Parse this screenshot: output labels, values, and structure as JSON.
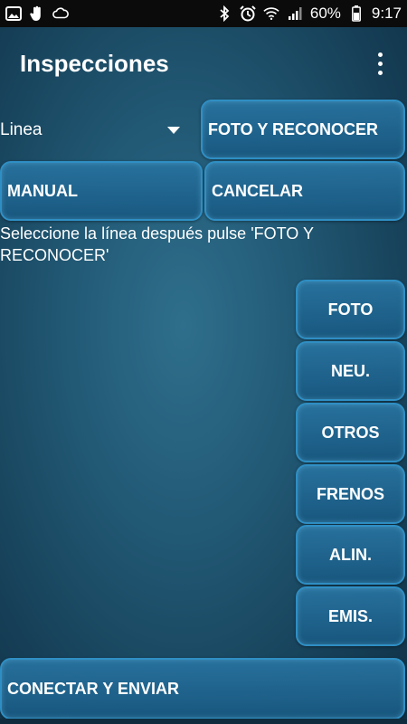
{
  "status_bar": {
    "battery": "60%",
    "time": "9:17",
    "icons_left": [
      "gallery-icon",
      "hand-icon",
      "cloud-icon"
    ],
    "icons_right": [
      "bluetooth-icon",
      "alarm-icon",
      "wifi-icon",
      "signal-icon",
      "battery-icon"
    ]
  },
  "app": {
    "title": "Inspecciones"
  },
  "controls": {
    "line_select_value": "Linea",
    "photo_recognize_label": "FOTO Y RECONOCER",
    "manual_label": "MANUAL",
    "cancel_label": "CANCELAR",
    "hint_text": "Seleccione la línea después pulse 'FOTO Y RECONOCER'"
  },
  "side_buttons": [
    {
      "label": "FOTO"
    },
    {
      "label": "NEU."
    },
    {
      "label": "OTROS"
    },
    {
      "label": "FRENOS"
    },
    {
      "label": "ALIN."
    },
    {
      "label": "EMIS."
    }
  ],
  "bottom": {
    "connect_send_label": "CONECTAR Y ENVIAR"
  },
  "colors": {
    "button_border": "#2f8fc4",
    "button_fill": "#1f6d9a",
    "background": "#225a76",
    "status_bar": "#0b0b0b"
  }
}
